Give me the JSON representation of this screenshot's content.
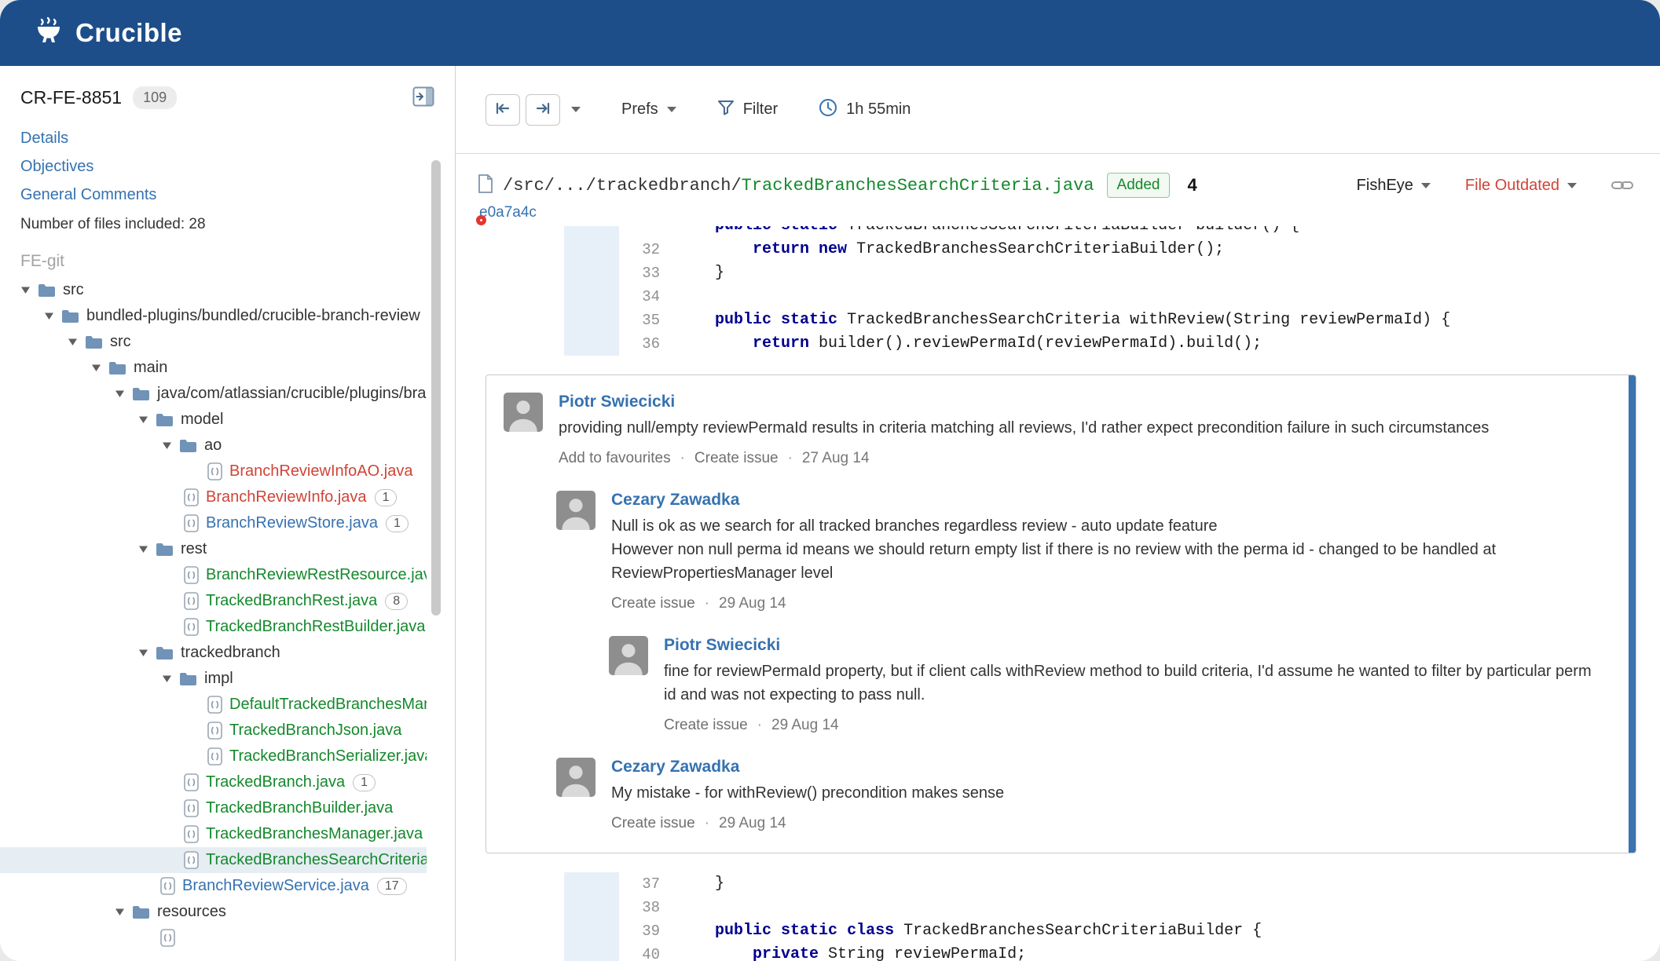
{
  "app": {
    "brand": "Crucible"
  },
  "colors": {
    "header_blue": "#1d4e8a",
    "link_blue": "#3572b0",
    "added_green": "#14892c",
    "alert_red": "#d04437",
    "keyword_blue": "#00008f",
    "unread_indicator_blue": "#3b73af"
  },
  "sidebar": {
    "review_id": "CR-FE-8851",
    "review_count": "109",
    "links": [
      "Details",
      "Objectives",
      "General Comments"
    ],
    "files_included": "Number of files included: 28",
    "repo_label": "FE-git",
    "tree": [
      {
        "type": "folder",
        "label": "src",
        "depth": 0
      },
      {
        "type": "folder",
        "label": "bundled-plugins/bundled/crucible-branch-review",
        "depth": 1
      },
      {
        "type": "folder",
        "label": "src",
        "depth": 2
      },
      {
        "type": "folder",
        "label": "main",
        "depth": 3
      },
      {
        "type": "folder",
        "label": "java/com/atlassian/crucible/plugins/branch",
        "depth": 4
      },
      {
        "type": "folder",
        "label": "model",
        "depth": 5
      },
      {
        "type": "folder",
        "label": "ao",
        "depth": 6
      },
      {
        "type": "file",
        "label": "BranchReviewInfoAO.java",
        "depth": 7,
        "color": "red"
      },
      {
        "type": "file",
        "label": "BranchReviewInfo.java",
        "depth": 6,
        "color": "red",
        "badge": "1"
      },
      {
        "type": "file",
        "label": "BranchReviewStore.java",
        "depth": 6,
        "color": "blue",
        "badge": "1"
      },
      {
        "type": "folder",
        "label": "rest",
        "depth": 5
      },
      {
        "type": "file",
        "label": "BranchReviewRestResource.java",
        "depth": 6,
        "color": "green"
      },
      {
        "type": "file",
        "label": "TrackedBranchRest.java",
        "depth": 6,
        "color": "green",
        "badge": "8"
      },
      {
        "type": "file",
        "label": "TrackedBranchRestBuilder.java",
        "depth": 6,
        "color": "green"
      },
      {
        "type": "folder",
        "label": "trackedbranch",
        "depth": 5
      },
      {
        "type": "folder",
        "label": "impl",
        "depth": 6
      },
      {
        "type": "file",
        "label": "DefaultTrackedBranchesManager.java",
        "depth": 7,
        "color": "green"
      },
      {
        "type": "file",
        "label": "TrackedBranchJson.java",
        "depth": 7,
        "color": "green"
      },
      {
        "type": "file",
        "label": "TrackedBranchSerializer.java",
        "depth": 7,
        "color": "green"
      },
      {
        "type": "file",
        "label": "TrackedBranch.java",
        "depth": 6,
        "color": "green",
        "badge": "1"
      },
      {
        "type": "file",
        "label": "TrackedBranchBuilder.java",
        "depth": 6,
        "color": "green"
      },
      {
        "type": "file",
        "label": "TrackedBranchesManager.java",
        "depth": 6,
        "color": "green"
      },
      {
        "type": "file",
        "label": "TrackedBranchesSearchCriteria.java",
        "depth": 6,
        "color": "green",
        "selected": true
      },
      {
        "type": "file",
        "label": "BranchReviewService.java",
        "depth": 5,
        "color": "blue",
        "badge": "17"
      },
      {
        "type": "folder",
        "label": "resources",
        "depth": 4
      },
      {
        "type": "file",
        "label": "",
        "depth": 5,
        "color": "green"
      }
    ]
  },
  "toolbar": {
    "prefs_label": "Prefs",
    "filter_label": "Filter",
    "time_label": "1h 55min"
  },
  "file_header": {
    "path_prefix": "/src/.../trackedbranch/",
    "file_name": "TrackedBranchesSearchCriteria.java",
    "status": "Added",
    "comment_count": "4",
    "fisheye_label": "FishEye",
    "outdated_label": "File Outdated",
    "revision": "e0a7a4c"
  },
  "diff": {
    "block1": {
      "partial_top": [
        [
          "p",
          "    "
        ],
        [
          "k",
          "public"
        ],
        [
          "p",
          " "
        ],
        [
          "k",
          "static"
        ],
        [
          "p",
          " TrackedBranchesSearchCriteriaBuilder builder() {"
        ]
      ],
      "lines": [
        {
          "num": "32",
          "tokens": [
            [
              "p",
              "        "
            ],
            [
              "k",
              "return"
            ],
            [
              "p",
              " "
            ],
            [
              "k",
              "new"
            ],
            [
              "p",
              " TrackedBranchesSearchCriteriaBuilder();"
            ]
          ]
        },
        {
          "num": "33",
          "tokens": [
            [
              "p",
              "    }"
            ]
          ]
        },
        {
          "num": "34",
          "tokens": []
        },
        {
          "num": "35",
          "tokens": [
            [
              "p",
              "    "
            ],
            [
              "k",
              "public"
            ],
            [
              "p",
              " "
            ],
            [
              "k",
              "static"
            ],
            [
              "p",
              " TrackedBranchesSearchCriteria withReview(String reviewPermaId) {"
            ]
          ]
        },
        {
          "num": "36",
          "tokens": [
            [
              "p",
              "        "
            ],
            [
              "k",
              "return"
            ],
            [
              "p",
              " builder().reviewPermaId(reviewPermaId).build();"
            ]
          ]
        }
      ]
    },
    "block2": {
      "lines": [
        {
          "num": "37",
          "tokens": [
            [
              "p",
              "    }"
            ]
          ]
        },
        {
          "num": "38",
          "tokens": []
        },
        {
          "num": "39",
          "tokens": [
            [
              "p",
              "    "
            ],
            [
              "k",
              "public"
            ],
            [
              "p",
              " "
            ],
            [
              "k",
              "static"
            ],
            [
              "p",
              " "
            ],
            [
              "k",
              "class"
            ],
            [
              "p",
              " TrackedBranchesSearchCriteriaBuilder {"
            ]
          ]
        },
        {
          "num": "40",
          "tokens": [
            [
              "p",
              "        "
            ],
            [
              "k",
              "private"
            ],
            [
              "p",
              " String reviewPermaId;"
            ]
          ]
        }
      ]
    }
  },
  "comments": [
    {
      "author": "Piotr Swiecicki",
      "depth": 0,
      "body": [
        "providing null/empty reviewPermaId results in criteria matching all reviews, I'd rather expect precondition failure in such circumstances"
      ],
      "actions": [
        "Add to favourites",
        "Create issue"
      ],
      "date": "27 Aug 14"
    },
    {
      "author": "Cezary Zawadka",
      "depth": 1,
      "body": [
        "Null is ok as we search for all tracked branches regardless review - auto update feature",
        "However non null perma id means we should return empty list if there is no review with the perma id - changed to be handled at ReviewPropertiesManager level"
      ],
      "actions": [
        "Create issue"
      ],
      "date": "29 Aug 14"
    },
    {
      "author": "Piotr Swiecicki",
      "depth": 2,
      "body": [
        "fine for reviewPermaId property, but if client calls withReview method to build criteria, I'd assume he wanted to filter by particular perm id and was not expecting to pass null."
      ],
      "actions": [
        "Create issue"
      ],
      "date": "29 Aug 14"
    },
    {
      "author": "Cezary Zawadka",
      "depth": 1,
      "body": [
        "My mistake - for withReview() precondition makes sense"
      ],
      "actions": [
        "Create issue"
      ],
      "date": "29 Aug 14"
    }
  ]
}
